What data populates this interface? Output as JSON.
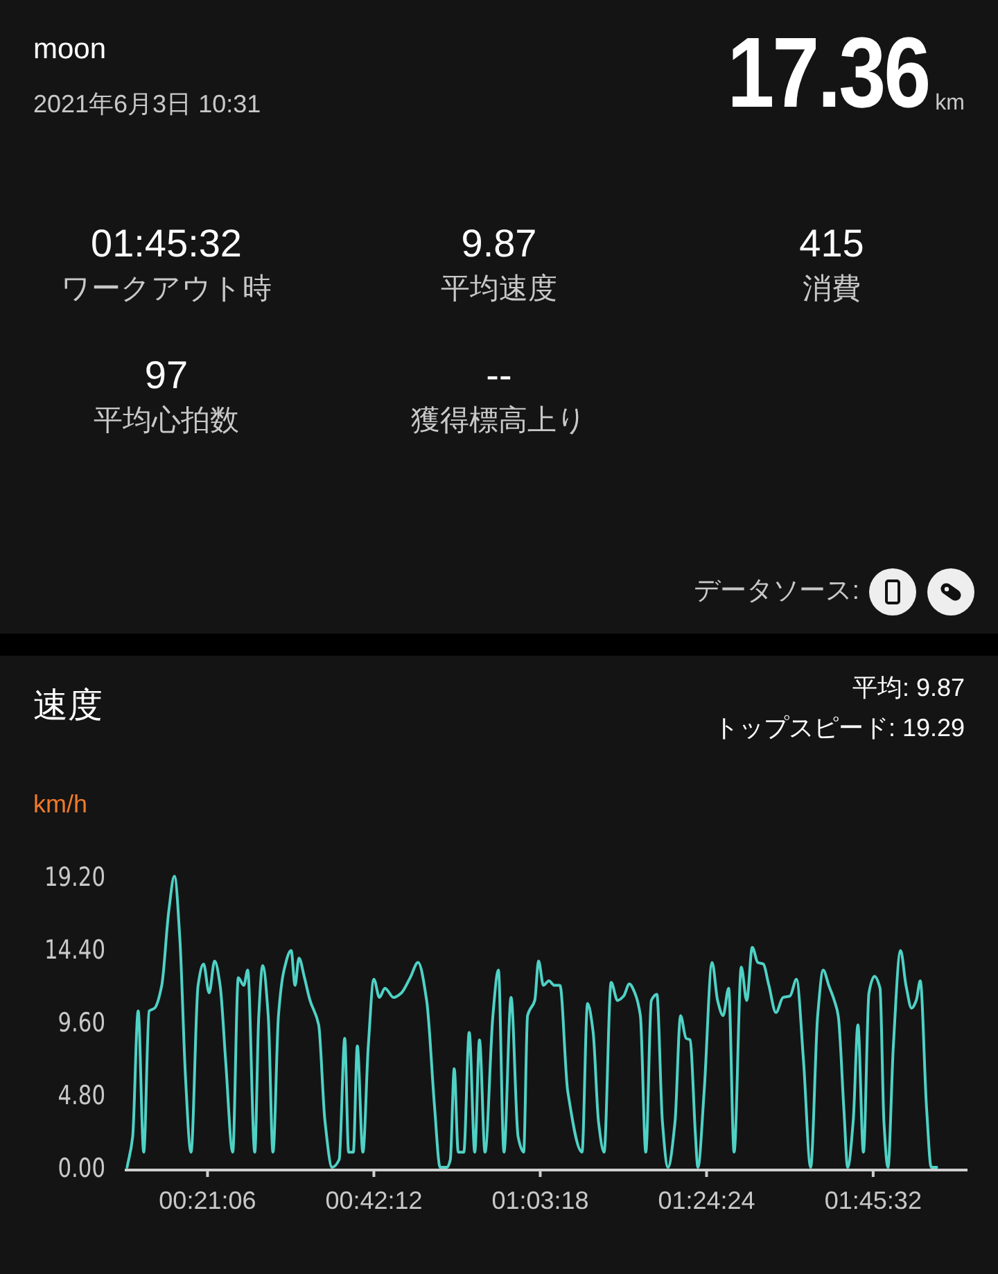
{
  "header": {
    "user": "moon",
    "datetime": "2021年6月3日 10:31",
    "distance": "17.36",
    "distance_unit": "km"
  },
  "stats": [
    {
      "value": "01:45:32",
      "label": "ワークアウト時"
    },
    {
      "value": "9.87",
      "label": "平均速度"
    },
    {
      "value": "415",
      "label": "消費"
    },
    {
      "value": "97",
      "label": "平均心拍数"
    },
    {
      "value": "--",
      "label": "獲得標高上り"
    }
  ],
  "data_source": {
    "label": "データソース:",
    "sources": [
      {
        "kind": "phone"
      },
      {
        "kind": "band"
      }
    ]
  },
  "speed": {
    "title": "速度",
    "average": "平均: 9.87",
    "top_speed": "トップスピード: 19.29",
    "chart_data": {
      "type": "line",
      "ylabel": "km/h",
      "xlim": [
        10.6,
        117.5
      ],
      "ylim": [
        0,
        19.2
      ],
      "xticks": [
        {
          "value": 21.1,
          "label": "00:21:06"
        },
        {
          "value": 42.2,
          "label": "00:42:12"
        },
        {
          "value": 63.3,
          "label": "01:03:18"
        },
        {
          "value": 84.4,
          "label": "01:24:24"
        },
        {
          "value": 105.533,
          "label": "01:45:32"
        }
      ],
      "yticks": [
        {
          "value": 0,
          "label": "0.00"
        },
        {
          "value": 4.8,
          "label": "4.80"
        },
        {
          "value": 9.6,
          "label": "9.60"
        },
        {
          "value": 14.4,
          "label": "14.40"
        },
        {
          "value": 19.2,
          "label": "19.20"
        }
      ],
      "x": [
        10.9,
        11.6,
        12.3,
        13.0,
        13.7,
        14.4,
        15.3,
        16.2,
        16.9,
        17.6,
        18.3,
        19.0,
        19.9,
        20.6,
        21.3,
        22.0,
        22.7,
        23.4,
        24.3,
        25.0,
        25.7,
        26.2,
        27.1,
        27.6,
        28.1,
        28.8,
        29.4,
        30.1,
        30.8,
        31.7,
        32.2,
        32.7,
        33.4,
        34.1,
        35.2,
        36.0,
        36.9,
        37.8,
        38.5,
        39.0,
        39.6,
        40.1,
        40.8,
        41.5,
        42.2,
        42.9,
        43.6,
        44.7,
        45.7,
        46.8,
        47.8,
        48.9,
        49.9,
        50.6,
        51.5,
        51.9,
        52.4,
        52.9,
        53.6,
        54.3,
        55.0,
        55.6,
        56.3,
        57.3,
        58.0,
        58.7,
        59.6,
        60.5,
        61.2,
        61.7,
        62.6,
        63.1,
        63.7,
        64.4,
        65.1,
        65.8,
        66.8,
        68.6,
        69.3,
        70.0,
        70.7,
        71.4,
        72.3,
        73.1,
        73.9,
        74.6,
        75.3,
        76.0,
        76.7,
        77.4,
        78.1,
        78.8,
        79.5,
        80.4,
        81.1,
        81.8,
        82.3,
        83.0,
        83.3,
        84.1,
        85.1,
        85.8,
        86.5,
        87.2,
        87.9,
        88.8,
        89.5,
        90.2,
        90.9,
        91.6,
        92.3,
        93.2,
        94.1,
        95.0,
        95.8,
        96.7,
        97.6,
        98.5,
        99.2,
        99.9,
        100.6,
        101.1,
        101.8,
        102.3,
        103.0,
        103.6,
        104.3,
        105.0,
        105.7,
        106.4,
        106.9,
        107.4,
        108.1,
        109.0,
        109.7,
        110.4,
        111.0,
        111.5,
        112.3,
        112.9,
        113.6
      ],
      "series": [
        {
          "color": "#4fd1c5",
          "values": [
            0,
            2,
            10.3,
            1,
            10.3,
            10.5,
            12,
            17,
            19.2,
            15,
            6,
            1,
            12,
            13.4,
            11.5,
            13.6,
            12,
            7,
            1,
            12.5,
            12,
            13,
            1,
            10,
            13.3,
            10,
            1,
            10,
            13,
            14.3,
            12,
            13.8,
            12.5,
            11,
            9.4,
            3,
            0,
            0.5,
            8.5,
            1,
            1,
            8,
            1,
            8,
            12.4,
            11.2,
            11.8,
            11.2,
            11.5,
            12.5,
            13.5,
            11,
            4,
            0,
            0,
            0.5,
            6.5,
            1,
            1,
            8.9,
            1,
            8.4,
            1,
            10,
            13,
            1,
            11.2,
            2,
            1,
            10,
            11,
            13.6,
            12,
            12.3,
            12,
            12,
            5,
            1,
            10.8,
            9,
            3,
            1,
            12.2,
            11,
            11.3,
            12.1,
            11.5,
            10,
            1,
            11,
            11.4,
            3,
            0,
            3,
            10,
            8.5,
            8.4,
            2,
            0,
            5,
            13.5,
            11,
            10,
            11.8,
            1,
            13.2,
            11,
            14.5,
            13.5,
            13.4,
            12,
            10.2,
            11.2,
            11.3,
            12.4,
            7,
            0,
            10,
            13,
            12,
            11,
            10,
            4,
            0,
            3,
            9.4,
            1,
            11.5,
            12.6,
            11.8,
            3,
            0,
            8,
            14.3,
            12,
            10.5,
            11,
            12.3,
            4,
            0,
            0
          ]
        }
      ]
    }
  }
}
